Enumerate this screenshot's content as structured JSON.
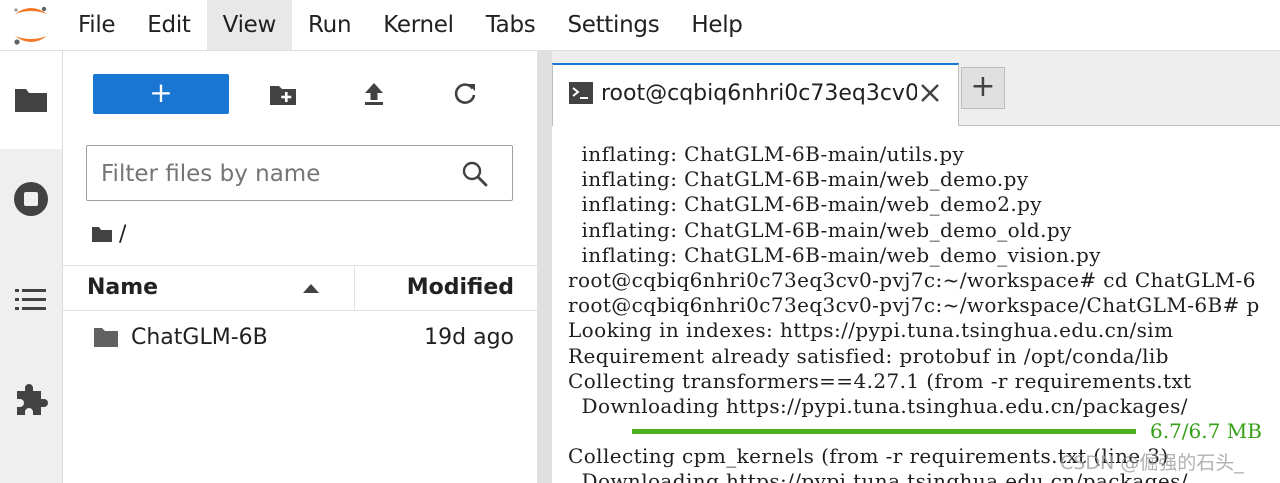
{
  "menu": {
    "items": [
      "File",
      "Edit",
      "View",
      "Run",
      "Kernel",
      "Tabs",
      "Settings",
      "Help"
    ],
    "active_index": 2
  },
  "sidebar": {
    "items": [
      {
        "icon": "folder-icon",
        "active": true
      },
      {
        "icon": "stop-circle-icon",
        "active": false
      },
      {
        "icon": "list-icon",
        "active": false
      },
      {
        "icon": "puzzle-icon",
        "active": false
      }
    ]
  },
  "filebrowser": {
    "new_label": "+",
    "filter_placeholder": "Filter files by name",
    "breadcrumb": "/",
    "columns": {
      "name": "Name",
      "modified": "Modified"
    },
    "files": [
      {
        "name": "ChatGLM-6B",
        "modified": "19d ago",
        "type": "folder"
      }
    ]
  },
  "tabs": {
    "terminal_title": "root@cqbiq6nhri0c73eq3cv0",
    "add_label": "+"
  },
  "terminal": {
    "lines": [
      "  inflating: ChatGLM-6B-main/utils.py",
      "  inflating: ChatGLM-6B-main/web_demo.py",
      "  inflating: ChatGLM-6B-main/web_demo2.py",
      "  inflating: ChatGLM-6B-main/web_demo_old.py",
      "  inflating: ChatGLM-6B-main/web_demo_vision.py",
      "root@cqbiq6nhri0c73eq3cv0-pvj7c:~/workspace# cd ChatGLM-6",
      "root@cqbiq6nhri0c73eq3cv0-pvj7c:~/workspace/ChatGLM-6B# p",
      "Looking in indexes: https://pypi.tuna.tsinghua.edu.cn/sim",
      "Requirement already satisfied: protobuf in /opt/conda/lib",
      "Collecting transformers==4.27.1 (from -r requirements.txt",
      "  Downloading https://pypi.tuna.tsinghua.edu.cn/packages/"
    ],
    "progress": {
      "fraction": 1.0,
      "text": "6.7/6.7 MB"
    },
    "lines_after": [
      "Collecting cpm_kernels (from -r requirements.txt (line 3)",
      "  Downloading https://pypi.tuna.tsinghua.edu.cn/packages/"
    ]
  },
  "watermark": "CSDN @倔强的石头_",
  "colors": {
    "accent": "#1976d2",
    "progress": "#4caf1d",
    "progress_text": "#35a015",
    "logo": "#f37726"
  }
}
